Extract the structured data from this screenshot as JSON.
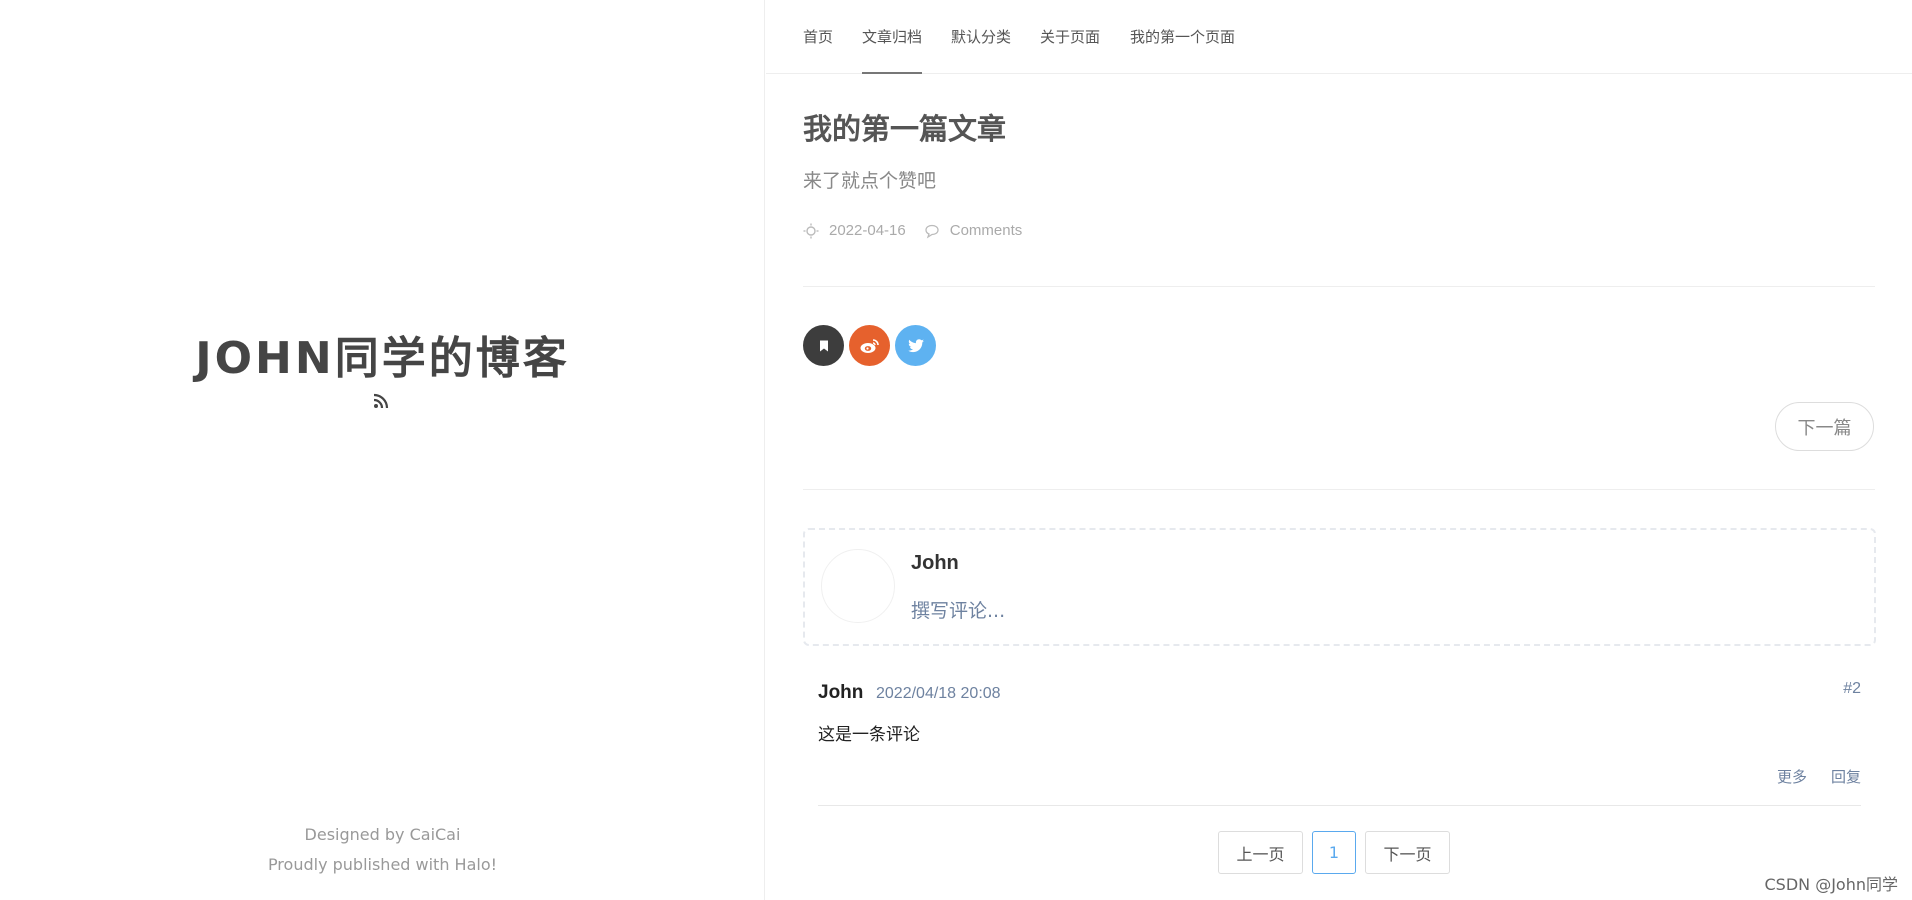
{
  "site": {
    "title": "JOHN同学的博客",
    "rss_icon": "rss-icon",
    "footer_designed": "Designed by CaiCai",
    "footer_published": "Proudly published with Halo!"
  },
  "nav": {
    "items": [
      {
        "label": "首页",
        "active": false
      },
      {
        "label": "文章归档",
        "active": true
      },
      {
        "label": "默认分类",
        "active": false
      },
      {
        "label": "关于页面",
        "active": false
      },
      {
        "label": "我的第一个页面",
        "active": false
      }
    ]
  },
  "post": {
    "title": "我的第一篇文章",
    "excerpt": "来了就点个赞吧",
    "date": "2022-04-16",
    "comments_label": "Comments",
    "next_label": "下一篇"
  },
  "share": {
    "buttons": [
      {
        "icon": "bookmark-icon",
        "color": "#3d3d3d"
      },
      {
        "icon": "weibo-icon",
        "color": "#e6612d"
      },
      {
        "icon": "twitter-icon",
        "color": "#5eb2f1"
      }
    ]
  },
  "comment_editor": {
    "name": "John",
    "placeholder": "撰写评论..."
  },
  "comments": [
    {
      "author": "John",
      "time": "2022/04/18 20:08",
      "index": "#2",
      "content": "这是一条评论",
      "more_label": "更多",
      "reply_label": "回复"
    }
  ],
  "pagination": {
    "prev_label": "上一页",
    "current": "1",
    "next_label": "下一页"
  },
  "watermark": "CSDN @John同学",
  "colors": {
    "accent_blue": "#5aa9ee",
    "link_gray_blue": "#6e82a0",
    "weibo": "#e6612d",
    "twitter": "#5eb2f1"
  }
}
